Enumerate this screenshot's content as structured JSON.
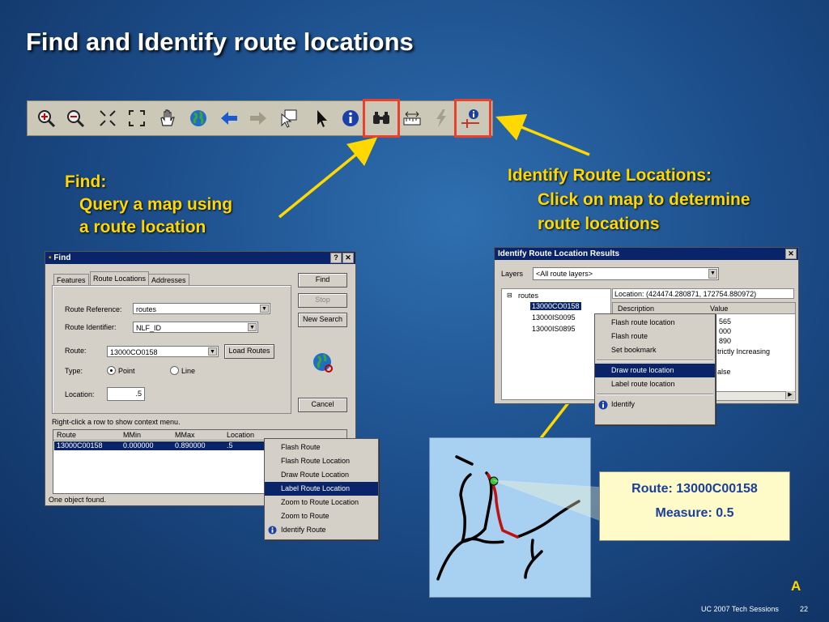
{
  "slide": {
    "title": "Find and Identify route locations",
    "label_a": "A",
    "footer_left": "UC 2007 Tech Sessions",
    "footer_right": "22"
  },
  "callouts": {
    "find_heading": "Find:",
    "find_line1": "Query a map using",
    "find_line2": "a route location",
    "identify_heading": "Identify Route Locations:",
    "identify_line1": "Click on map to determine",
    "identify_line2": "route locations"
  },
  "toolbar": {
    "icons": [
      "zoom-in-icon",
      "zoom-out-icon",
      "fixed-zoom-in-icon",
      "fixed-zoom-out-icon",
      "pan-hand-icon",
      "full-extent-globe-icon",
      "back-arrow-icon",
      "forward-arrow-icon",
      "select-features-icon",
      "select-pointer-icon",
      "identify-info-icon",
      "find-binoculars-icon",
      "measure-icon",
      "hyperlink-lightning-icon",
      "identify-route-locations-icon"
    ]
  },
  "find_window": {
    "title": "Find",
    "tabs": [
      "Features",
      "Route Locations",
      "Addresses"
    ],
    "route_reference_label": "Route Reference:",
    "route_reference_value": "routes",
    "route_identifier_label": "Route Identifier:",
    "route_identifier_value": "NLF_ID",
    "route_label": "Route:",
    "route_value": "13000CO0158",
    "load_routes_button": "Load Routes",
    "type_label": "Type:",
    "type_point": "Point",
    "type_line": "Line",
    "location_label": "Location:",
    "location_value": ".5",
    "find_button": "Find",
    "stop_button": "Stop",
    "new_search_button": "New Search",
    "cancel_button": "Cancel",
    "hint": "Right-click a row to show context menu.",
    "columns": [
      "Route",
      "MMin",
      "MMax",
      "Location"
    ],
    "rows": [
      [
        "13000C00158",
        "0.000000",
        "0.890000",
        ".5"
      ]
    ],
    "status": "One object found.",
    "context_menu": [
      "Flash Route",
      "Flash Route Location",
      "Draw Route Location",
      "Label Route Location",
      "Zoom to Route Location",
      "Zoom to Route",
      "Identify Route"
    ]
  },
  "identify_window": {
    "title": "Identify Route Location Results",
    "layers_label": "Layers",
    "layers_value": "<All route layers>",
    "tree_root": "routes",
    "tree_items": [
      "13000CO0158",
      "13000IS0095",
      "13000IS0895"
    ],
    "location_header": "Location: (424474.280871, 172754.880972)",
    "col_description": "Description",
    "col_value": "Value",
    "values_partial": [
      "565",
      "000",
      "890",
      "trictly Increasing",
      "",
      "alse"
    ],
    "context_menu": [
      "Flash route location",
      "Flash route",
      "Set bookmark",
      "Draw route  location",
      "Label route location",
      "Identify"
    ]
  },
  "map_label": {
    "route": "Route: 13000C00158",
    "measure": "Measure: 0.5"
  },
  "colors": {
    "highlight_box": "#e8402a",
    "callout_yellow": "#ffd800",
    "selection_blue": "#0a246a"
  }
}
